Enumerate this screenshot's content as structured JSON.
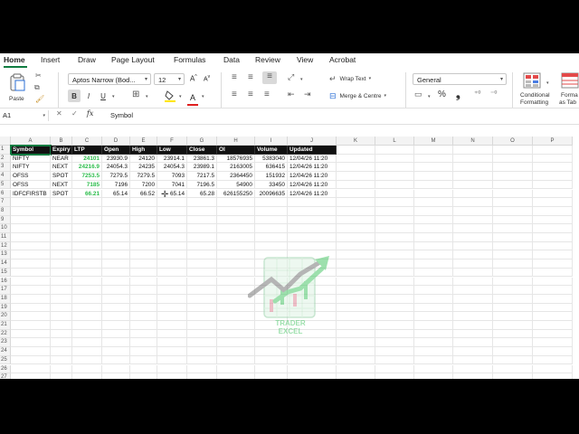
{
  "tabs": [
    "Home",
    "Insert",
    "Draw",
    "Page Layout",
    "Formulas",
    "Data",
    "Review",
    "View",
    "Acrobat"
  ],
  "ribbon": {
    "paste_label": "Paste",
    "font_name": "Aptos Narrow (Bod...",
    "font_size": "12",
    "bold": "B",
    "italic": "I",
    "underline": "U",
    "wrap_text": "Wrap Text",
    "merge_center": "Merge & Centre",
    "number_format": "General",
    "percent": "%",
    "comma": "❟",
    "conditional_formatting": [
      "Conditional",
      "Formatting"
    ],
    "format_as_table": [
      "Forma",
      "as Tab"
    ]
  },
  "formula_bar": {
    "cell_ref": "A1",
    "fx": "fx",
    "value": "Symbol"
  },
  "columns": [
    "A",
    "B",
    "C",
    "D",
    "E",
    "F",
    "G",
    "H",
    "I",
    "J",
    "K",
    "L",
    "M",
    "N",
    "O",
    "P"
  ],
  "row_numbers": [
    "1",
    "2",
    "3",
    "4",
    "5",
    "6",
    "7",
    "8",
    "9",
    "10",
    "11",
    "12",
    "13",
    "14",
    "15",
    "16",
    "17",
    "18",
    "19",
    "20",
    "21",
    "22",
    "23",
    "24",
    "25",
    "26",
    "27",
    "28"
  ],
  "table": {
    "headers": [
      "Symbol",
      "Expiry",
      "LTP",
      "Open",
      "High",
      "Low",
      "Close",
      "OI",
      "Volume",
      "Updated"
    ],
    "rows": [
      [
        "NIFTY",
        "NEAR",
        "24101",
        "23930.9",
        "24120",
        "23914.1",
        "23861.3",
        "18576935",
        "5383040",
        "12/04/26 11:20"
      ],
      [
        "NIFTY",
        "NEXT",
        "24216.9",
        "24054.3",
        "24235",
        "24054.3",
        "23989.1",
        "2163005",
        "636415",
        "12/04/26 11:20"
      ],
      [
        "OFSS",
        "SPOT",
        "7253.5",
        "7279.5",
        "7279.5",
        "7093",
        "7217.5",
        "2364450",
        "151932",
        "12/04/26 11:20"
      ],
      [
        "OFSS",
        "NEXT",
        "7185",
        "7196",
        "7200",
        "7041",
        "7196.5",
        "54900",
        "33450",
        "12/04/26 11:20"
      ],
      [
        "IDFCFIRSTB",
        "SPOT",
        "66.21",
        "65.14",
        "66.52",
        "65.14",
        "65.28",
        "626155250",
        "20096635",
        "12/04/26 11:20"
      ]
    ]
  },
  "watermark": {
    "line1": "TRADER",
    "line2": "EXCEL"
  },
  "colors": {
    "accent": "#107c41",
    "ltp_green": "#2dbd4c",
    "header_bg": "#111111"
  }
}
